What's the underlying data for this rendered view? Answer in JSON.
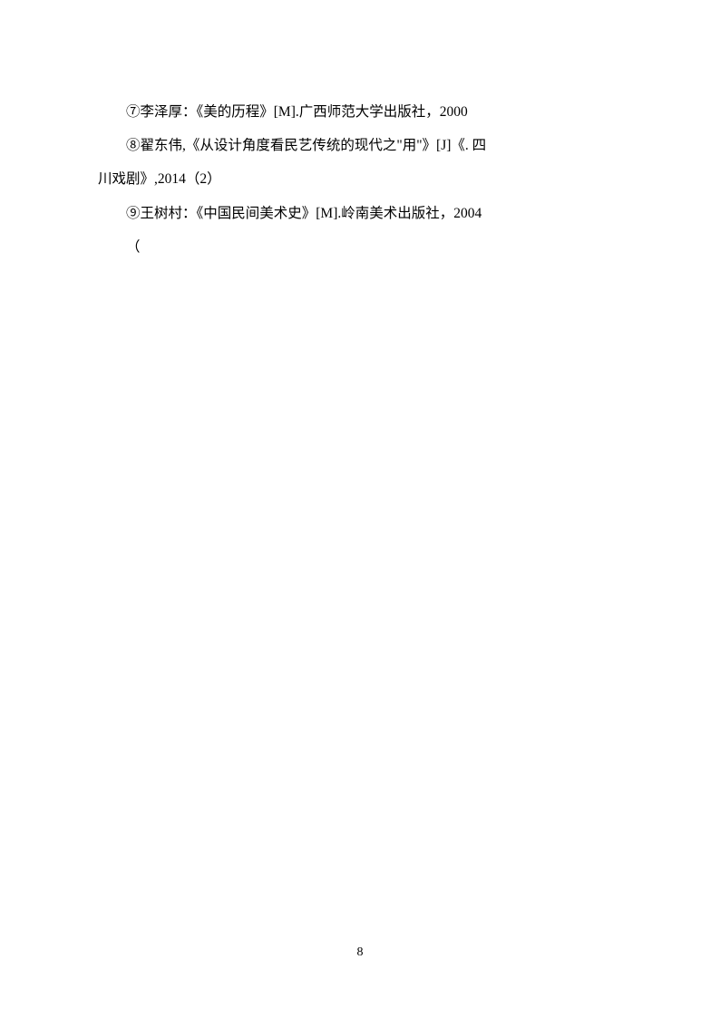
{
  "references": {
    "line1": "⑦李泽厚：《美的历程》[M].广西师范大学出版社，2000",
    "line2": "⑧翟东伟,《从设计角度看民艺传统的现代之\"用\"》[J]《. 四",
    "line3": "川戏剧》,2014（2）",
    "line4": "⑨王树村：《中国民间美术史》[M].岭南美术出版社，2004",
    "line5": "（"
  },
  "pageNumber": "8"
}
